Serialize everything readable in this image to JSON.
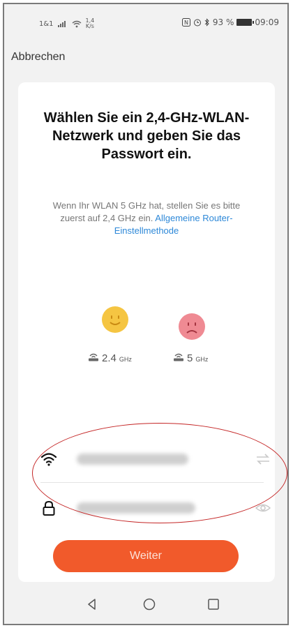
{
  "status_bar": {
    "carrier": "1&1",
    "speed_value": "1,4",
    "speed_unit": "K/s",
    "battery_percent": "93 %",
    "time": "09:09"
  },
  "header": {
    "cancel_label": "Abbrechen"
  },
  "card": {
    "title": "Wählen Sie ein 2,4-GHz-WLAN-Netzwerk und geben Sie das Passwort ein.",
    "description": "Wenn Ihr WLAN 5 GHz hat, stellen Sie es bitte zuerst auf 2,4 GHz ein.",
    "help_link": "Allgemeine Router-Einstellmethode",
    "bands": [
      {
        "number": "2.4",
        "unit": "GHz",
        "icon": "smiley-happy-icon",
        "color": "#f5c542"
      },
      {
        "number": "5",
        "unit": "GHz",
        "icon": "smiley-sad-icon",
        "color": "#ef8a93"
      }
    ],
    "wifi_field": {
      "icon": "wifi-icon",
      "value": ""
    },
    "password_field": {
      "icon": "lock-icon",
      "value": ""
    },
    "next_button_label": "Weiter"
  },
  "colors": {
    "accent": "#f15a2b",
    "link": "#2d88d8",
    "annotation": "#c42525"
  }
}
